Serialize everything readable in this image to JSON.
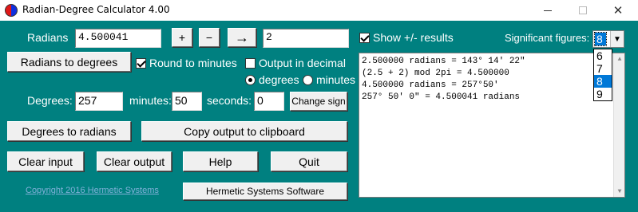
{
  "window": {
    "title": "Radian-Degree Calculator 4.00",
    "minimize_icon": "minimize-icon",
    "maximize_icon": "maximize-icon",
    "close_icon": "close-icon",
    "close_glyph": "✕"
  },
  "radians": {
    "label": "Radians",
    "value": "4.500041",
    "plus_label": "+",
    "minus_label": "−",
    "arrow_label": "→",
    "arrow_target_value": "2"
  },
  "options": {
    "show_pm_label": "Show +/- results",
    "show_pm_checked": true,
    "round_minutes_label": "Round to minutes",
    "round_minutes_checked": true,
    "output_decimal_label": "Output in decimal",
    "output_decimal_checked": false,
    "radio_degrees_label": "degrees",
    "radio_minutes_label": "minutes",
    "radio_selected": "degrees"
  },
  "significant_figures": {
    "label": "Significant figures:",
    "selected": "8",
    "options": [
      "6",
      "7",
      "8",
      "9"
    ]
  },
  "buttons": {
    "radians_to_degrees": "Radians to degrees",
    "change_sign": "Change sign",
    "degrees_to_radians": "Degrees to radians",
    "copy_output": "Copy output to clipboard",
    "clear_input": "Clear input",
    "clear_output": "Clear output",
    "help": "Help",
    "quit": "Quit",
    "hermetic": "Hermetic Systems Software"
  },
  "degrees": {
    "label": "Degrees:",
    "value": "257",
    "minutes_label": "minutes:",
    "minutes_value": "50",
    "seconds_label": "seconds:",
    "seconds_value": "0"
  },
  "output": {
    "lines": [
      "2.500000 radians = 143° 14' 22\"",
      "(2.5 + 2) mod 2pi = 4.500000",
      "4.500000 radians = 257°50'",
      "257° 50' 0\" = 4.500041 radians"
    ]
  },
  "footer": {
    "copyright": "Copyright 2016 Hermetic Systems"
  },
  "colors": {
    "client_background": "#008080",
    "selection": "#0078d7"
  }
}
